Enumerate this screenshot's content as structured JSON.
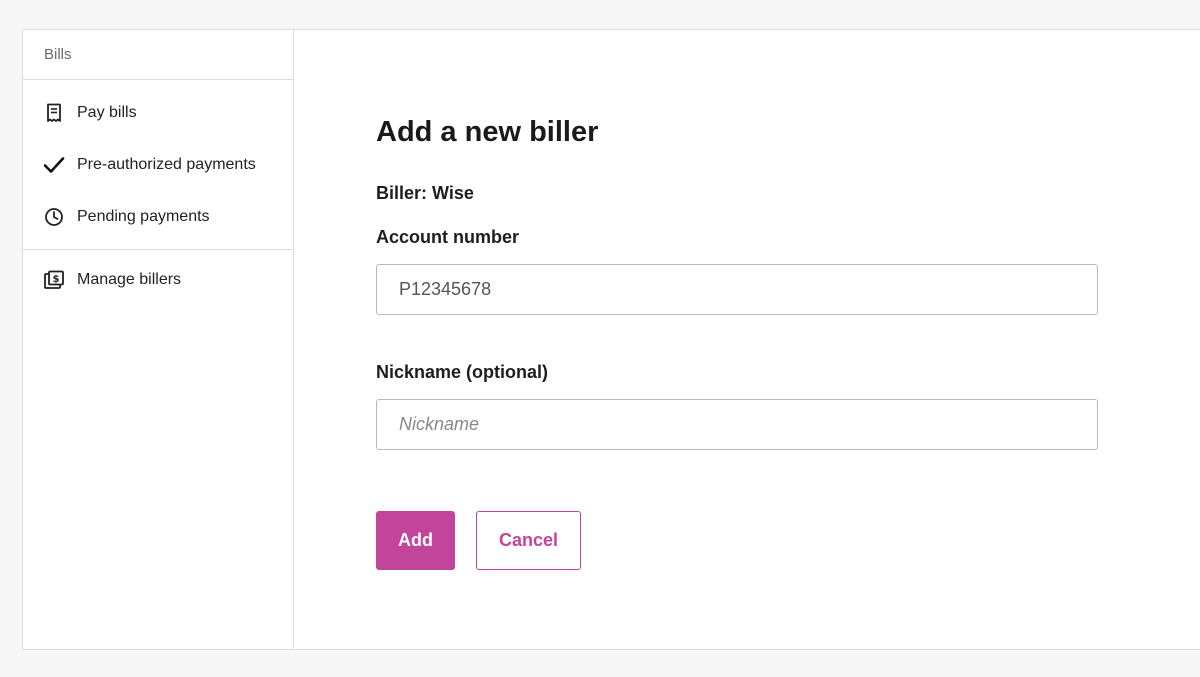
{
  "sidebar": {
    "title": "Bills",
    "items": [
      {
        "label": "Pay bills",
        "icon": "receipt-icon"
      },
      {
        "label": "Pre-authorized payments",
        "icon": "checkmark-icon"
      },
      {
        "label": "Pending payments",
        "icon": "clock-icon"
      },
      {
        "label": "Manage billers",
        "icon": "biller-book-icon"
      }
    ]
  },
  "form": {
    "title": "Add a new biller",
    "biller": "Biller: Wise",
    "account_label": "Account number",
    "account_value": "P12345678",
    "nickname_label": "Nickname (optional)",
    "nickname_placeholder": "Nickname",
    "add_label": "Add",
    "cancel_label": "Cancel"
  },
  "colors": {
    "accent": "#c2449b",
    "border": "#dcdcdc",
    "background": "#f7f7f7"
  }
}
